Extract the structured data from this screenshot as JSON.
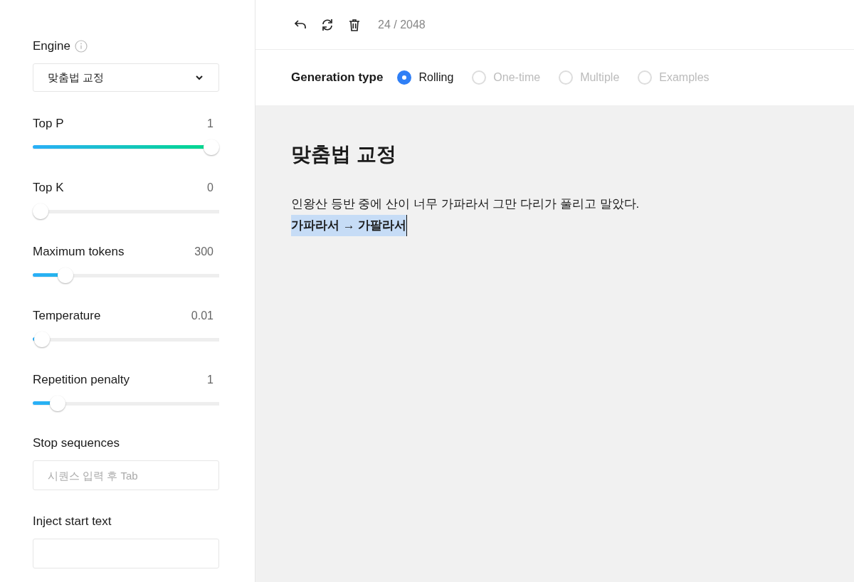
{
  "sidebar": {
    "engine": {
      "label": "Engine",
      "value": "맞춤법 교정"
    },
    "sliders": [
      {
        "label": "Top P",
        "reading": "1",
        "level": 1
      },
      {
        "label": "Top K",
        "reading": "0",
        "level": 0
      },
      {
        "label": "Maximum tokens",
        "reading": "300",
        "level": 0.146
      },
      {
        "label": "Temperature",
        "reading": "0.01",
        "level": 0.01
      },
      {
        "label": "Repetition penalty",
        "reading": "1",
        "level": 0.1
      }
    ],
    "fields": [
      {
        "label": "Stop sequences",
        "placeholder": "시퀀스 입력 후 Tab"
      },
      {
        "label": "Inject start text"
      }
    ]
  },
  "toolbar": {
    "counter": "24 / 2048"
  },
  "generation_type": {
    "label": "Generation type",
    "options": [
      {
        "label": "Rolling",
        "selected": true,
        "disabled": false
      },
      {
        "label": "One-time",
        "selected": false,
        "disabled": true
      },
      {
        "label": "Multiple",
        "selected": false,
        "disabled": true
      },
      {
        "label": "Examples",
        "selected": false,
        "disabled": true
      }
    ]
  },
  "document": {
    "title": "맞춤법 교정",
    "lines": [
      {
        "text": "인왕산 등반 중에 산이 너무 가파라서 그만 다리가 풀리고 말았다.",
        "bold": false,
        "selected": false
      },
      {
        "text": "가파라서 → 가팔라서",
        "bold": true,
        "selected": true
      }
    ]
  }
}
